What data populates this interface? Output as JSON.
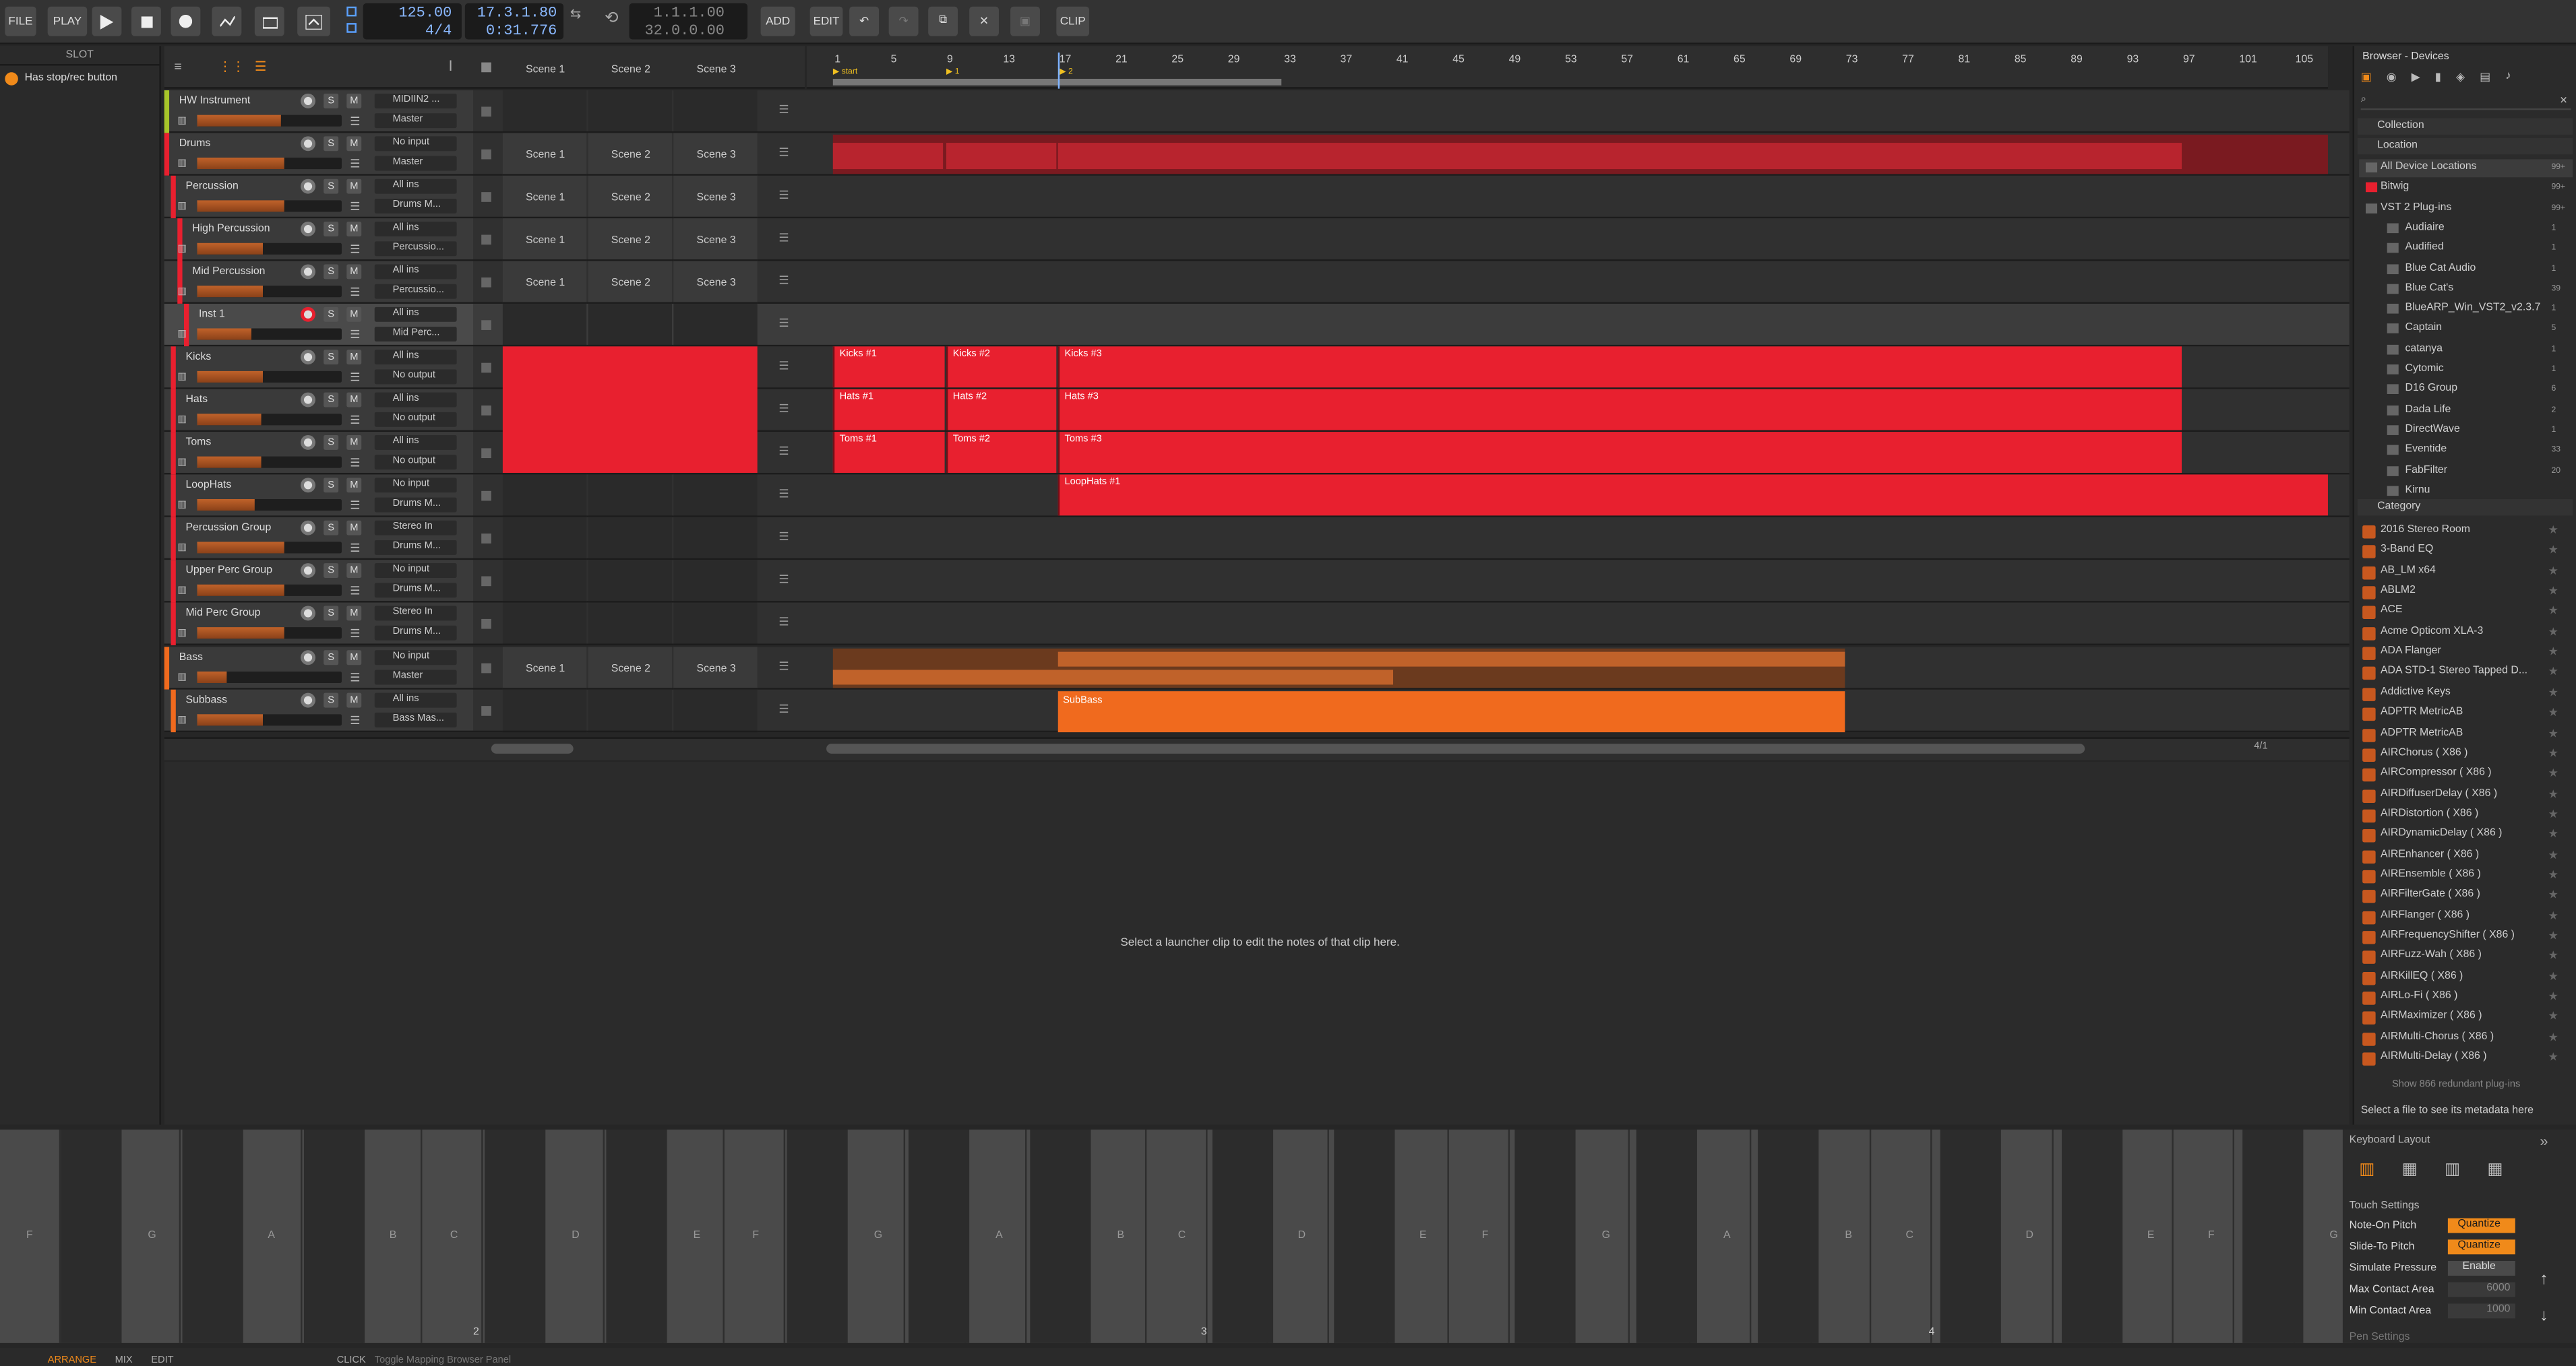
{
  "toolbar": {
    "file": "FILE",
    "play": "PLAY",
    "tempo": "125.00",
    "signature": "4/4",
    "position": "17.3.1.80",
    "time": "0:31.776",
    "loop_start": "1.1.1.00",
    "loop_len": "32.0.0.00",
    "add": "ADD",
    "edit": "EDIT",
    "clip": "CLIP"
  },
  "inspector": {
    "title": "SLOT",
    "stop_rec_label": "Has stop/rec button"
  },
  "scenes": [
    "Scene 1",
    "Scene 2",
    "Scene 3"
  ],
  "tracks": [
    {
      "name": "HW Instrument",
      "input": "MIDIIN2 ...",
      "output": "Master"
    },
    {
      "name": "Drums",
      "input": "No input",
      "output": "Master"
    },
    {
      "name": "Percussion",
      "input": "All ins",
      "output": "Drums M..."
    },
    {
      "name": "High Percussion",
      "input": "All ins",
      "output": "Percussio..."
    },
    {
      "name": "Mid Percussion",
      "input": "All ins",
      "output": "Percussio..."
    },
    {
      "name": "Inst 1",
      "input": "All ins",
      "output": "Mid Perc..."
    },
    {
      "name": "Kicks",
      "input": "All ins",
      "output": "No output"
    },
    {
      "name": "Hats",
      "input": "All ins",
      "output": "No output"
    },
    {
      "name": "Toms",
      "input": "All ins",
      "output": "No output"
    },
    {
      "name": "LoopHats",
      "input": "No input",
      "output": "Drums M..."
    },
    {
      "name": "Percussion Group",
      "input": "Stereo In",
      "output": "Drums M..."
    },
    {
      "name": "Upper Perc Group",
      "input": "No input",
      "output": "Drums M..."
    },
    {
      "name": "Mid Perc Group",
      "input": "Stereo In",
      "output": "Drums M..."
    },
    {
      "name": "Bass",
      "input": "No input",
      "output": "Master"
    },
    {
      "name": "Subbass",
      "input": "All ins",
      "output": "Bass Mas..."
    }
  ],
  "ruler": [
    "1",
    "5",
    "9",
    "13",
    "17",
    "21",
    "25",
    "29",
    "33",
    "37",
    "41",
    "45",
    "49",
    "53",
    "57",
    "61",
    "65",
    "69",
    "73",
    "77",
    "81",
    "85",
    "89",
    "93",
    "97",
    "101",
    "105"
  ],
  "markers": {
    "start": "start",
    "m1": "1",
    "m2": "2"
  },
  "clips": {
    "kicks": [
      "Kicks #1",
      "Kicks #2",
      "Kicks #3"
    ],
    "hats": [
      "Hats #1",
      "Hats #2",
      "Hats #3"
    ],
    "toms": [
      "Toms #1",
      "Toms #2",
      "Toms #3"
    ],
    "loophats": "LoopHats #1",
    "subbass": "SubBass"
  },
  "detail": {
    "message": "Select a launcher clip to edit the notes of that clip here."
  },
  "zoom": "4/1",
  "browser": {
    "title": "Browser - Devices",
    "collection": "Collection",
    "location": "Location",
    "category": "Category",
    "locations": [
      {
        "name": "All Device Locations",
        "count": "99+"
      },
      {
        "name": "Bitwig",
        "count": "99+"
      },
      {
        "name": "VST 2 Plug-ins",
        "count": "99+"
      },
      {
        "name": "Audiaire",
        "count": "1"
      },
      {
        "name": "Audified",
        "count": "1"
      },
      {
        "name": "Blue Cat Audio",
        "count": "1"
      },
      {
        "name": "Blue Cat's",
        "count": "39"
      },
      {
        "name": "BlueARP_Win_VST2_v2.3.7",
        "count": "1"
      },
      {
        "name": "Captain",
        "count": "5"
      },
      {
        "name": "catanya",
        "count": "1"
      },
      {
        "name": "Cytomic",
        "count": "1"
      },
      {
        "name": "D16 Group",
        "count": "6"
      },
      {
        "name": "Dada Life",
        "count": "2"
      },
      {
        "name": "DirectWave",
        "count": "1"
      },
      {
        "name": "Eventide",
        "count": "33"
      },
      {
        "name": "FabFilter",
        "count": "20"
      },
      {
        "name": "Kirnu",
        "count": ""
      }
    ],
    "devices": [
      "2016 Stereo Room",
      "3-Band EQ",
      "AB_LM x64",
      "ABLM2",
      "ACE",
      "Acme Opticom XLA-3",
      "ADA Flanger",
      "ADA STD-1 Stereo Tapped D...",
      "Addictive Keys",
      "ADPTR MetricAB",
      "ADPTR MetricAB",
      "AIRChorus ( X86 )",
      "AIRCompressor ( X86 )",
      "AIRDiffuserDelay ( X86 )",
      "AIRDistortion ( X86 )",
      "AIRDynamicDelay ( X86 )",
      "AIREnhancer ( X86 )",
      "AIREnsemble ( X86 )",
      "AIRFilterGate ( X86 )",
      "AIRFlanger ( X86 )",
      "AIRFrequencyShifter ( X86 )",
      "AIRFuzz-Wah ( X86 )",
      "AIRKillEQ ( X86 )",
      "AIRLo-Fi ( X86 )",
      "AIRMaximizer ( X86 )",
      "AIRMulti-Chorus ( X86 )",
      "AIRMulti-Delay ( X86 )"
    ],
    "redundant": "Show 866 redundant plug-ins",
    "metadata": "Select a file to see its metadata here"
  },
  "keyboard": {
    "white_labels": [
      "F",
      "G",
      "A",
      "B",
      "C",
      "D",
      "E",
      "F",
      "G",
      "A",
      "B",
      "C",
      "D",
      "E",
      "F",
      "G",
      "A",
      "B",
      "C",
      "D",
      "E",
      "F",
      "G"
    ],
    "octaves": [
      "2",
      "3",
      "4"
    ],
    "layout_title": "Keyboard Layout",
    "touch_title": "Touch Settings",
    "settings": [
      {
        "label": "Note-On Pitch",
        "value": "Quantize"
      },
      {
        "label": "Slide-To Pitch",
        "value": "Quantize"
      },
      {
        "label": "Simulate Pressure",
        "value": "Enable"
      },
      {
        "label": "Max Contact Area",
        "value": "6000"
      },
      {
        "label": "Min Contact Area",
        "value": "1000"
      }
    ],
    "pen_settings": "Pen Settings"
  },
  "status": {
    "arrange": "ARRANGE",
    "mix": "MIX",
    "edit": "EDIT",
    "hint_key": "CLICK",
    "hint": "Toggle Mapping Browser Panel"
  }
}
